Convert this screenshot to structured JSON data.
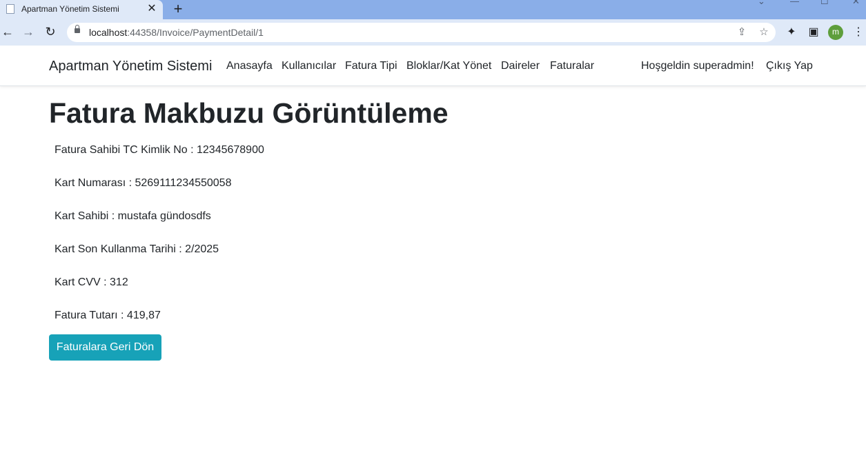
{
  "browser": {
    "tab_title": "Apartman Yönetim Sistemi",
    "url_host": "localhost",
    "url_path": ":44358/Invoice/PaymentDetail/1",
    "profile_initial": "m",
    "icons": [
      "back-arrow-icon",
      "forward-arrow-icon",
      "reload-icon",
      "lock-icon",
      "share-icon",
      "star-icon",
      "extensions-icon",
      "side-panel-icon",
      "kebab-menu-icon"
    ]
  },
  "navbar": {
    "brand": "Apartman Yönetim Sistemi",
    "links": [
      "Anasayfa",
      "Kullanıcılar",
      "Fatura Tipi",
      "Bloklar/Kat Yönet",
      "Daireler",
      "Faturalar"
    ],
    "greeting": "Hoşgeldin superadmin!",
    "logout": "Çıkış Yap"
  },
  "main": {
    "title": "Fatura Makbuzu Görüntüleme",
    "fields": [
      "Fatura Sahibi TC Kimlik No : 12345678900",
      "Kart Numarası : 5269111234550058",
      "Kart Sahibi : mustafa gündosdfs",
      "Kart Son Kullanma Tarihi : 2/2025",
      "Kart CVV : 312",
      "Fatura Tutarı : 419,87"
    ],
    "back_button": "Faturalara Geri Dön"
  },
  "colors": {
    "button_bg": "#17a2b8",
    "tabstrip": "#8aaee8",
    "toolbar": "#dfe9f8"
  }
}
